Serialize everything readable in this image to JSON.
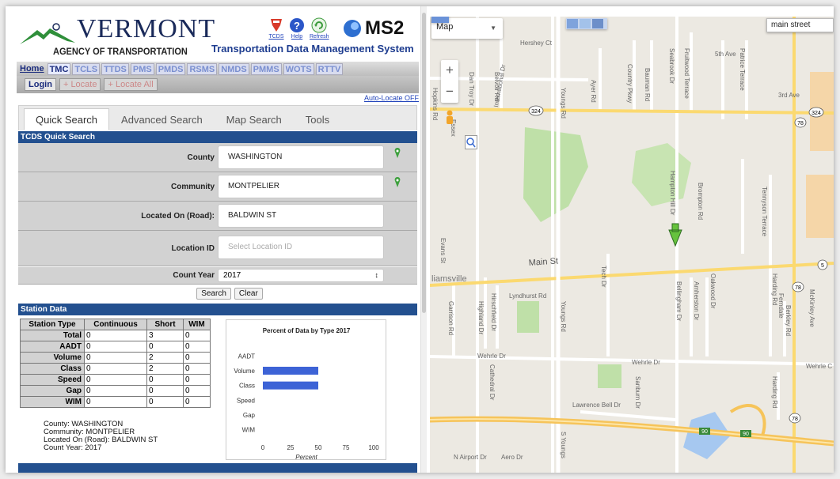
{
  "header": {
    "agency_name": "VERMONT",
    "agency_sub": "AGENCY OF TRANSPORTATION",
    "system_title": "Transportation Data Management System",
    "brand": "MS2",
    "icons": [
      {
        "name": "tcds-icon",
        "label": "TCDS"
      },
      {
        "name": "help-icon",
        "label": "Help"
      },
      {
        "name": "refresh-icon",
        "label": "Refresh"
      }
    ]
  },
  "nav": {
    "items": [
      "Home",
      "TMC",
      "TCLS",
      "TTDS",
      "PMS",
      "PMDS",
      "RSMS",
      "NMDS",
      "PMMS",
      "WOTS",
      "RTTV"
    ]
  },
  "subnav": {
    "login": "Login",
    "locate": "Locate",
    "locate_all": "Locate All"
  },
  "auto_locate": "Auto-Locate OFF",
  "tabs": [
    "Quick Search",
    "Advanced Search",
    "Map Search",
    "Tools"
  ],
  "quick_search": {
    "header": "TCDS Quick Search",
    "county_label": "County",
    "county_value": "WASHINGTON",
    "community_label": "Community",
    "community_value": "MONTPELIER",
    "road_label": "Located On (Road):",
    "road_value": "BALDWIN ST",
    "location_label": "Location ID",
    "location_placeholder": "Select Location ID",
    "year_label": "Count Year",
    "year_value": "2017",
    "search_btn": "Search",
    "clear_btn": "Clear"
  },
  "station_data": {
    "header": "Station Data",
    "columns": [
      "Station Type",
      "Continuous",
      "Short",
      "WIM"
    ],
    "rows": [
      {
        "label": "Total",
        "continuous": "0",
        "short": "3",
        "wim": "0"
      },
      {
        "label": "AADT",
        "continuous": "0",
        "short": "0",
        "wim": "0"
      },
      {
        "label": "Volume",
        "continuous": "0",
        "short": "2",
        "wim": "0"
      },
      {
        "label": "Class",
        "continuous": "0",
        "short": "2",
        "wim": "0"
      },
      {
        "label": "Speed",
        "continuous": "0",
        "short": "0",
        "wim": "0"
      },
      {
        "label": "Gap",
        "continuous": "0",
        "short": "0",
        "wim": "0"
      },
      {
        "label": "WIM",
        "continuous": "0",
        "short": "0",
        "wim": "0"
      }
    ],
    "info": {
      "county": "County: WASHINGTON",
      "community": "Community: MONTPELIER",
      "road": "Located On (Road): BALDWIN ST",
      "year": "Count Year: 2017"
    }
  },
  "chart_data": {
    "type": "bar",
    "orientation": "horizontal",
    "title": "Percent of Data by Type 2017",
    "xlabel": "Percent",
    "ylabel": "",
    "categories": [
      "AADT",
      "Volume",
      "Class",
      "Speed",
      "Gap",
      "WIM"
    ],
    "values": [
      0,
      50,
      50,
      0,
      0,
      0
    ],
    "xlim": [
      0,
      100
    ],
    "xticks": [
      0,
      25,
      50,
      75,
      100
    ],
    "bar_color": "#3d63d6"
  },
  "map": {
    "map_type": "Map",
    "search_value": "main street",
    "labels": {
      "main_st": "Main St",
      "wehrle": "Wehrle Dr",
      "wehrle2": "Wehrle Dr",
      "wehrle3": "Wehrle C",
      "lawrence_bell": "Lawrence Bell Dr",
      "lyndhurst": "Lyndhurst Rd",
      "williamsville": "liamsville",
      "hershey": "Hershey Ct",
      "fifth_ave": "5th Ave",
      "third_ave": "3rd Ave",
      "youngs_rd": "Youngs Rd",
      "youngs_rd2": "Youngs Rd",
      "youngs_s": "S Youngs",
      "n_airport": "N Airport Dr",
      "hopkins": "Hopkins Rd",
      "evans": "Evans St",
      "garrison": "Garrison Rd",
      "highland": "Highland Dr",
      "hirschfield": "Hirschfield Dr",
      "cathedral": "Cathedral Dr",
      "dan_troy": "Dan Troy Dr",
      "belvoir": "Belvoir Rd",
      "international": "International Dr",
      "essex": "Essex",
      "ayer": "Ayer Rd",
      "country": "Country Pkwy",
      "bauman": "Bauman Rd",
      "seabrook": "Seabrook Dr",
      "fruitwood": "Fruitwood Terrace",
      "patrice": "Patrice Terrace",
      "tech": "Tech Dr",
      "hampton": "Hampton Hill Dr",
      "brompton": "Brompton Rd",
      "amherston": "Amherston Dr",
      "bellingham": "Bellingham Dr",
      "oakwood": "Oakwood Dr",
      "tennyson": "Tennyson Terrace",
      "harding": "Harding Rd",
      "harding2": "Harding Rd",
      "ferndale": "Ferndale",
      "berkley": "Berkley Rd",
      "mckinley": "McKinley Ave",
      "sanburn": "Sanburn Dr",
      "aero": "Aero Dr",
      "shield_324a": "324",
      "shield_324b": "324",
      "shield_78a": "78",
      "shield_78b": "78",
      "shield_78c": "78",
      "shield_5": "5",
      "shield_90a": "90",
      "shield_90b": "90"
    }
  }
}
